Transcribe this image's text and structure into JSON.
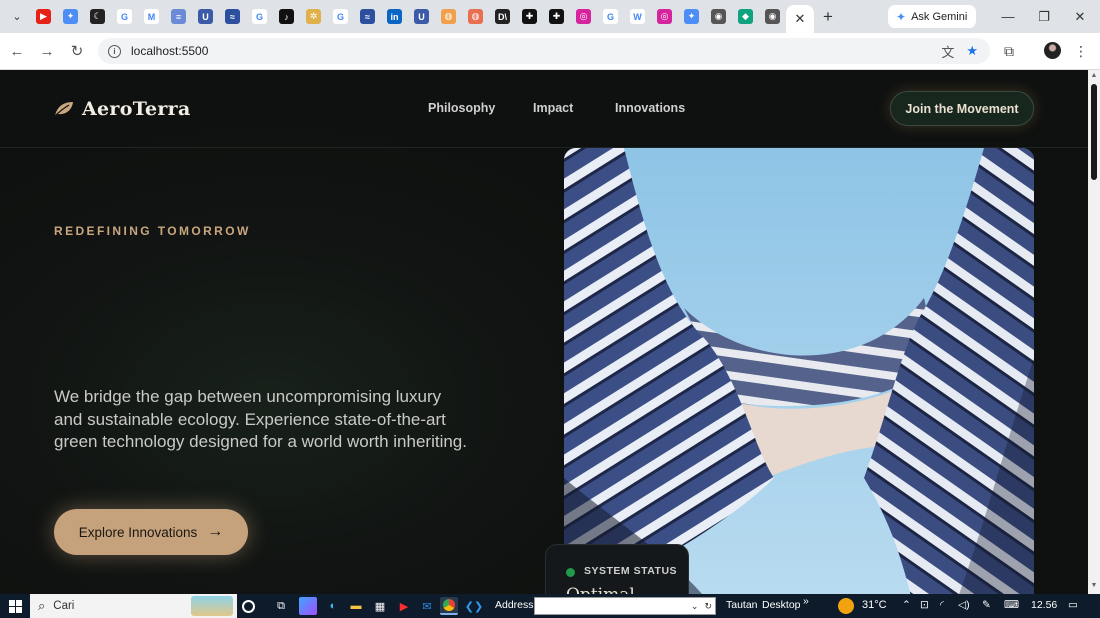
{
  "browser": {
    "tab_icons": [
      {
        "name": "youtube-tab-icon",
        "color": "#e62117",
        "glyph": "▶"
      },
      {
        "name": "gemini-tab-icon",
        "color": "#4c8df6",
        "glyph": "✦"
      },
      {
        "name": "moon-tab-icon",
        "color": "#222222",
        "glyph": "☾"
      },
      {
        "name": "google-tab-icon",
        "color": "#ffffff",
        "glyph": "G"
      },
      {
        "name": "gmail-tab-icon",
        "color": "#ffffff",
        "glyph": "M"
      },
      {
        "name": "doc-tab-icon",
        "color": "#6b8bd6",
        "glyph": "≡"
      },
      {
        "name": "u-tab-icon",
        "color": "#3b5ba9",
        "glyph": "U"
      },
      {
        "name": "wave-tab-icon",
        "color": "#2c4f9e",
        "glyph": "≈"
      },
      {
        "name": "google-tab-icon",
        "color": "#ffffff",
        "glyph": "G"
      },
      {
        "name": "tiktok-tab-icon",
        "color": "#111111",
        "glyph": "♪"
      },
      {
        "name": "sun-tab-icon",
        "color": "#e0b14a",
        "glyph": "✲"
      },
      {
        "name": "google-tab-icon",
        "color": "#ffffff",
        "glyph": "G"
      },
      {
        "name": "wave-tab-icon",
        "color": "#2c4f9e",
        "glyph": "≈"
      },
      {
        "name": "linkedin-tab-icon",
        "color": "#0a66c2",
        "glyph": "in"
      },
      {
        "name": "u-tab-icon",
        "color": "#3b5ba9",
        "glyph": "U"
      },
      {
        "name": "colorful-tab-icon",
        "color": "#f0a04b",
        "glyph": "◍"
      },
      {
        "name": "colorful-tab-icon",
        "color": "#e86f4f",
        "glyph": "◍"
      },
      {
        "name": "dx-tab-icon",
        "color": "#222222",
        "glyph": "D\\"
      },
      {
        "name": "plus-box-tab-icon",
        "color": "#111111",
        "glyph": "✚"
      },
      {
        "name": "plus-box-tab-icon",
        "color": "#111111",
        "glyph": "✚"
      },
      {
        "name": "instagram-tab-icon",
        "color": "#d6249f",
        "glyph": "◎"
      },
      {
        "name": "google-tab-icon",
        "color": "#ffffff",
        "glyph": "G"
      },
      {
        "name": "wikipedia-tab-icon",
        "color": "#ffffff",
        "glyph": "W"
      },
      {
        "name": "instagram-tab-icon",
        "color": "#d6249f",
        "glyph": "◎"
      },
      {
        "name": "gemini-tab-icon",
        "color": "#4c8df6",
        "glyph": "✦"
      },
      {
        "name": "globe-tab-icon",
        "color": "#555555",
        "glyph": "◉"
      },
      {
        "name": "diamond-tab-icon",
        "color": "#10a37f",
        "glyph": "◆"
      },
      {
        "name": "globe-tab-icon",
        "color": "#555555",
        "glyph": "◉"
      }
    ],
    "gemini_label": "Ask Gemini",
    "url": "localhost:5500"
  },
  "site": {
    "brand": "AeroTerra",
    "nav": {
      "philosophy": "Philosophy",
      "impact": "Impact",
      "innovations": "Innovations",
      "join": "Join the Movement"
    },
    "hero": {
      "eyebrow": "REDEFINING TOMORROW",
      "body": "We bridge the gap between uncompromising luxury and sustainable ecology. Experience state-of-the-art green technology designed for a world worth inheriting.",
      "cta": "Explore Innovations"
    },
    "status": {
      "label": "SYSTEM STATUS",
      "value": "Optimal"
    }
  },
  "taskbar": {
    "search_placeholder": "Cari",
    "address_label": "Address",
    "tautan": "Tautan",
    "desktop": "Desktop",
    "temperature": "31°C",
    "time": "12.56"
  },
  "colors": {
    "accent_gold": "#c5a27c",
    "status_green": "#1f9b4a",
    "page_bg": "#111412"
  }
}
